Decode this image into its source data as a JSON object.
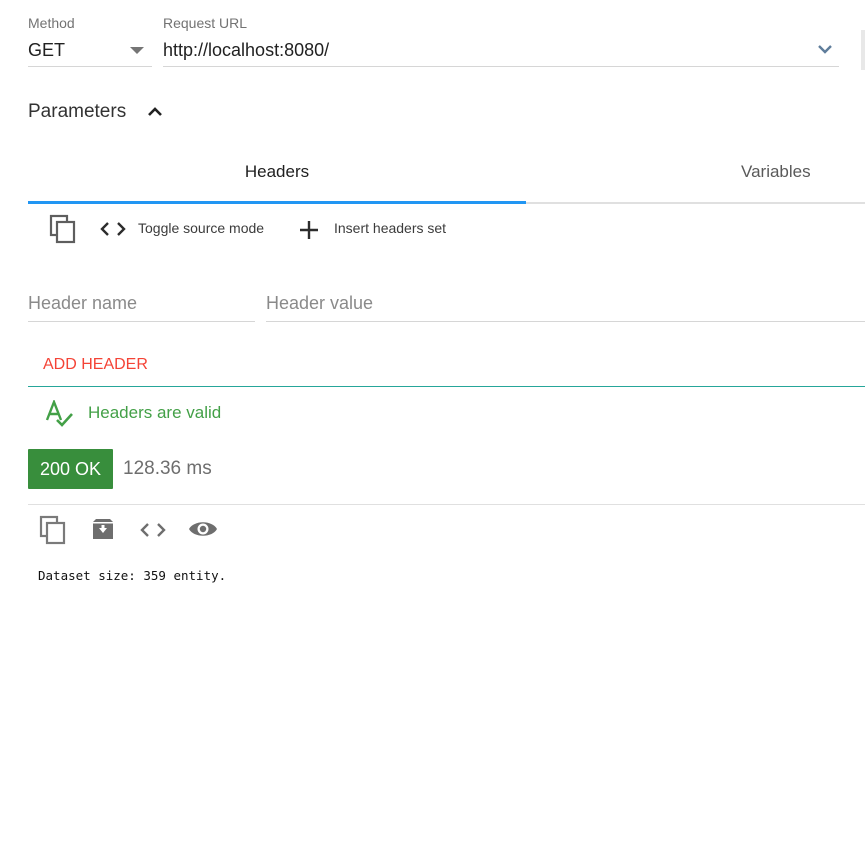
{
  "request": {
    "method_label": "Method",
    "method_value": "GET",
    "url_label": "Request URL",
    "url_value": "http://localhost:8080/"
  },
  "parameters": {
    "title": "Parameters",
    "tabs": [
      {
        "label": "Headers",
        "active": true
      },
      {
        "label": "Variables",
        "active": false
      }
    ]
  },
  "headers_toolbar": {
    "copy_icon": "copy-icon",
    "toggle_label": "Toggle source mode",
    "insert_label": "Insert headers set"
  },
  "header_form": {
    "name_placeholder": "Header name",
    "value_placeholder": "Header value",
    "add_label": "ADD HEADER",
    "valid_label": "Headers are valid"
  },
  "response": {
    "status": "200 OK",
    "time": "128.36 ms",
    "body_text": "Dataset size: 359 entity."
  },
  "colors": {
    "accent": "#2196f3",
    "add_header": "#f44336",
    "valid_green": "#43a047",
    "status_green": "#388e3c",
    "divider_teal": "#26a69a"
  }
}
